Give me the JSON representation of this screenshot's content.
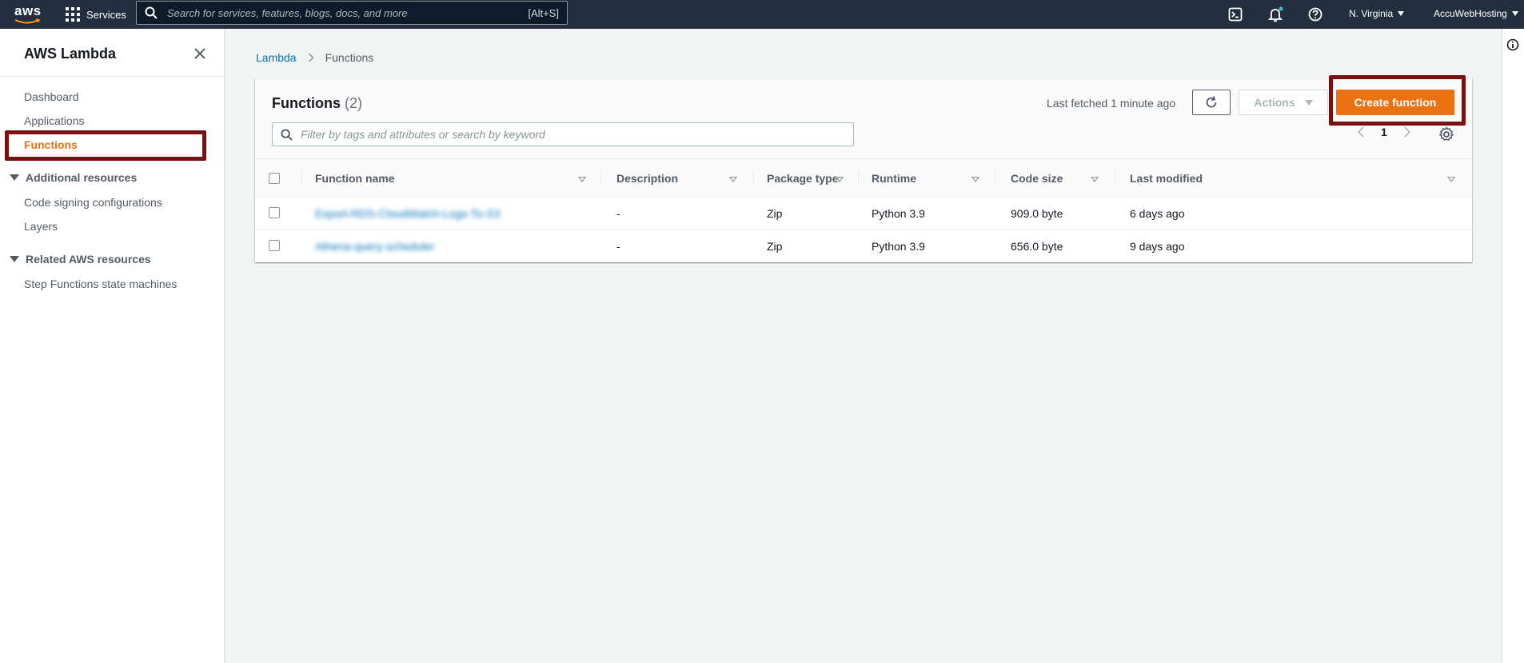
{
  "topnav": {
    "logo_text": "aws",
    "services_label": "Services",
    "search_placeholder": "Search for services, features, blogs, docs, and more",
    "search_shortcut": "[Alt+S]",
    "region": "N. Virginia",
    "account": "AccuWebHosting",
    "icons": [
      "cloudshell-icon",
      "bell-icon",
      "help-icon"
    ]
  },
  "sidebar": {
    "title": "AWS Lambda",
    "items": [
      {
        "label": "Dashboard",
        "active": false
      },
      {
        "label": "Applications",
        "active": false
      },
      {
        "label": "Functions",
        "active": true
      }
    ],
    "sections": [
      {
        "label": "Additional resources",
        "items": [
          "Code signing configurations",
          "Layers"
        ]
      },
      {
        "label": "Related AWS resources",
        "items": [
          "Step Functions state machines"
        ]
      }
    ]
  },
  "breadcrumb": {
    "parent": "Lambda",
    "current": "Functions"
  },
  "panel": {
    "title": "Functions",
    "count": "(2)",
    "last_fetched": "Last fetched 1 minute ago",
    "actions_label": "Actions",
    "create_label": "Create function",
    "filter_placeholder": "Filter by tags and attributes or search by keyword",
    "page": "1"
  },
  "table": {
    "columns": [
      "Function name",
      "Description",
      "Package type",
      "Runtime",
      "Code size",
      "Last modified"
    ],
    "rows": [
      {
        "name": "Export-RDS-CloudWatch-Logs-To-S3",
        "description": "-",
        "package": "Zip",
        "runtime": "Python 3.9",
        "size": "909.0 byte",
        "modified": "6 days ago"
      },
      {
        "name": "Athena-query-scheduler",
        "description": "-",
        "package": "Zip",
        "runtime": "Python 3.9",
        "size": "656.0 byte",
        "modified": "9 days ago"
      }
    ]
  },
  "colors": {
    "accent": "#ec7211",
    "link": "#0073bb",
    "nav_bg": "#232f3e",
    "highlight": "#7b1010"
  }
}
